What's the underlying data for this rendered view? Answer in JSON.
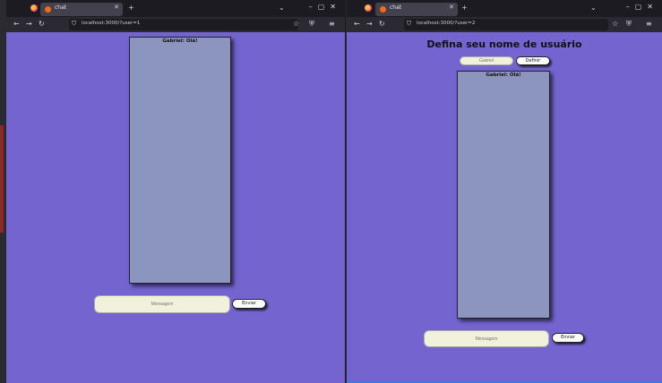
{
  "left_window": {
    "tab_title": "chat",
    "url": "localhost:3000/?user=1",
    "chat_messages": [
      "Gabriel: Olá!"
    ],
    "message_input": {
      "placeholder": "Mensagem"
    },
    "send_label": "Enviar"
  },
  "right_window": {
    "tab_title": "chat",
    "url": "localhost:3000/?user=2",
    "heading": "Defina seu nome de usuário",
    "name_input": {
      "placeholder": "Gabriel"
    },
    "define_label": "Definir",
    "chat_messages": [
      "Gabriel: Olá!"
    ],
    "message_input": {
      "placeholder": "Mensagem"
    },
    "send_label": "Enviar"
  },
  "colors": {
    "page_background": "#7464d0",
    "chat_box": "#8c95bd",
    "input_background": "#f2f2dc"
  }
}
